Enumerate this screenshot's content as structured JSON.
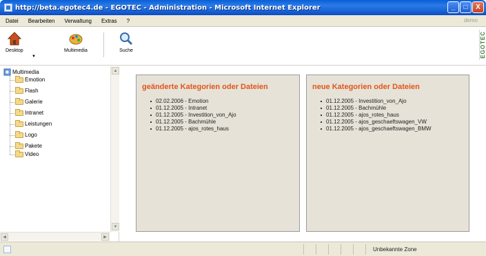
{
  "window": {
    "title": "http://beta.egotec4.de - EGOTEC - Administration - Microsoft Internet Explorer",
    "minimize": "_",
    "maximize": "□",
    "close": "X"
  },
  "menu": {
    "items": [
      "Datei",
      "Bearbeiten",
      "Verwaltung",
      "Extras",
      "?"
    ],
    "user": "demo"
  },
  "toolbar": {
    "desktop_label": "Desktop",
    "dropdown_arrow": "▼",
    "multimedia_label": "Multimedia",
    "search_label": "Suche",
    "logo_text": "EGOTEC"
  },
  "tree": {
    "root": "Multimedia",
    "items": [
      "Emotion",
      "Flash",
      "Galerie",
      "Intranet",
      "Leistungen",
      "Logo",
      "Pakete",
      "Video"
    ]
  },
  "scroll": {
    "up": "▲",
    "down": "▼",
    "left": "◀",
    "right": "▶"
  },
  "panels": {
    "changed": {
      "heading": "geänderte Kategorien oder Dateien",
      "entries": [
        "02.02.2006 - Emotion",
        "01.12.2005 - Intranet",
        "01.12.2005 - Investition_von_Ajo",
        "01.12.2005 - Bachmühle",
        "01.12.2005 - ajos_rotes_haus"
      ]
    },
    "new": {
      "heading": "neue Kategorien oder Dateien",
      "entries": [
        "01.12.2005 - Investition_von_Ajo",
        "01.12.2005 - Bachmühle",
        "01.12.2005 - ajos_rotes_haus",
        "01.12.2005 - ajos_geschaeftswagen_VW",
        "01.12.2005 - ajos_geschaeftswagen_BMW"
      ]
    }
  },
  "status": {
    "zone": "Unbekannte Zone"
  },
  "colors": {
    "heading": "#e0561c",
    "panel_bg": "#e6e2d7",
    "titlebar": "#1a64d8"
  }
}
